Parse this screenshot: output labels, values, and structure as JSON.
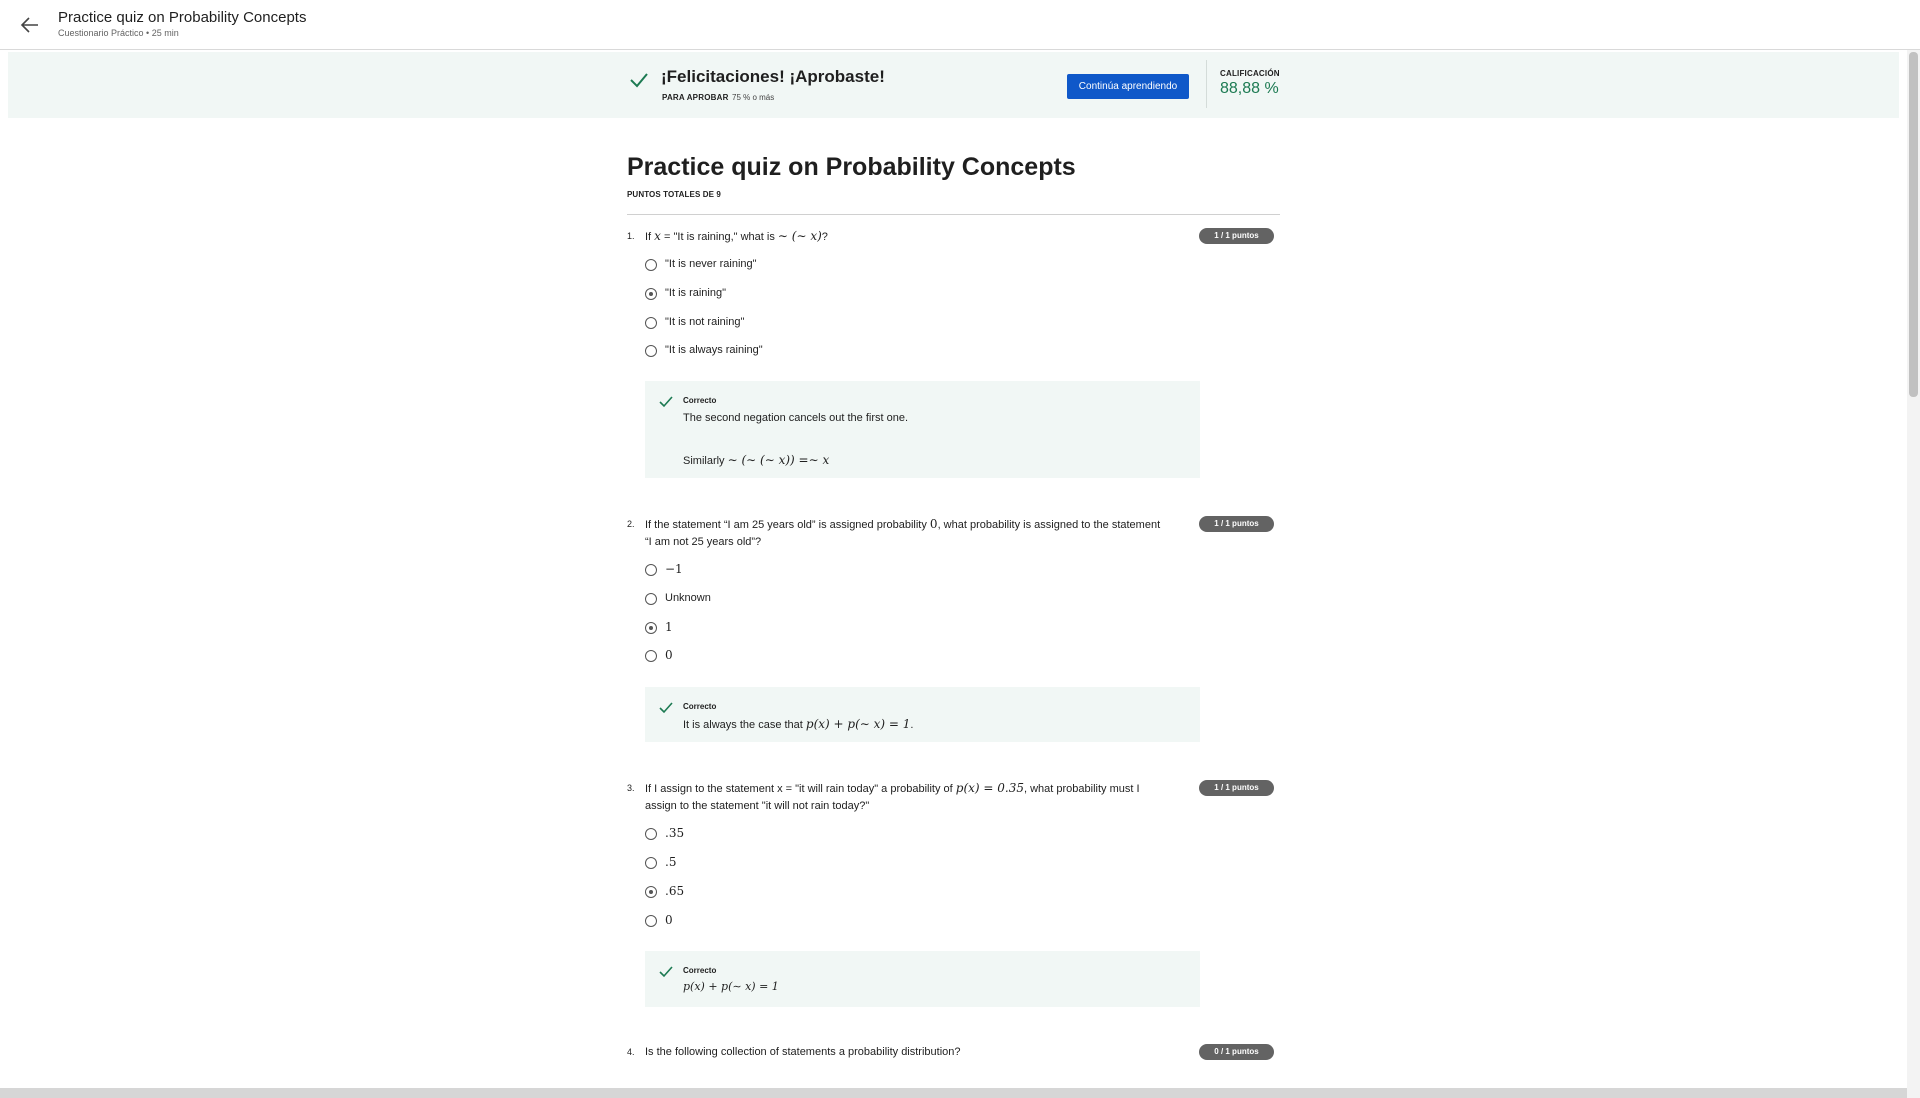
{
  "header": {
    "title": "Practice quiz on Probability Concepts",
    "subtitle": "Cuestionario Práctico • 25 min",
    "back_icon": "arrow-left-icon"
  },
  "result": {
    "title": "¡Felicitaciones! ¡Aprobaste!",
    "pass_label": "PARA APROBAR",
    "pass_value": "75 % o más",
    "continue_label": "Continúa aprendiendo",
    "grade_label": "CALIFICACIÓN",
    "grade_value": "88,88 %",
    "grade_color": "#1c7a52",
    "button_color": "#0f58c9"
  },
  "quiz": {
    "title": "Practice quiz on Probability Concepts",
    "total_points": "PUNTOS TOTALES DE 9"
  },
  "questions": [
    {
      "number": "1.",
      "text_before": "If ",
      "math_x": "x",
      "text_mid": " = \"It is raining,\" what is ",
      "math_expr": "∼ (∼ x)",
      "text_after": "?",
      "points": "1 / 1 puntos",
      "options": [
        "\"It is never raining\"",
        "\"It is raining\"",
        "\"It is not raining\"",
        "\"It is always raining\""
      ],
      "selected_index": 1,
      "feedback": {
        "label": "Correcto",
        "line1": "The second negation cancels out the first one.",
        "line2_text": "Similarly ",
        "line2_math": "∼ (∼ (∼ x)) =∼ x"
      }
    },
    {
      "number": "2.",
      "line1_before": "If the statement “I am 25 years old” is assigned probability ",
      "line1_math": "0",
      "line1_after": ", what probability is assigned to the statement",
      "line2": "“I am not 25 years old”?",
      "points": "1 / 1 puntos",
      "options": [
        "−1",
        "Unknown",
        "1",
        "0"
      ],
      "selected_index": 2,
      "feedback": {
        "label": "Correcto",
        "text": "It is always the case that ",
        "math": "p(x) + p(∼ x) = 1",
        "text_after": "."
      }
    },
    {
      "number": "3.",
      "line1_before": "If I assign to the statement x = \"it will rain today\" a probability of ",
      "line1_math": "p(x) = 0.35",
      "line1_after": ", what probability must I",
      "line2": "assign to the statement \"it will not rain today?\"",
      "points": "1 / 1 puntos",
      "options": [
        ".35",
        ".5",
        ".65",
        "0"
      ],
      "selected_index": 2,
      "feedback": {
        "label": "Correcto",
        "math": "p(x) + p(∼ x) = 1"
      }
    },
    {
      "number": "4.",
      "text": "Is the following collection of statements a probability distribution?",
      "points": "0 / 1 puntos"
    }
  ]
}
